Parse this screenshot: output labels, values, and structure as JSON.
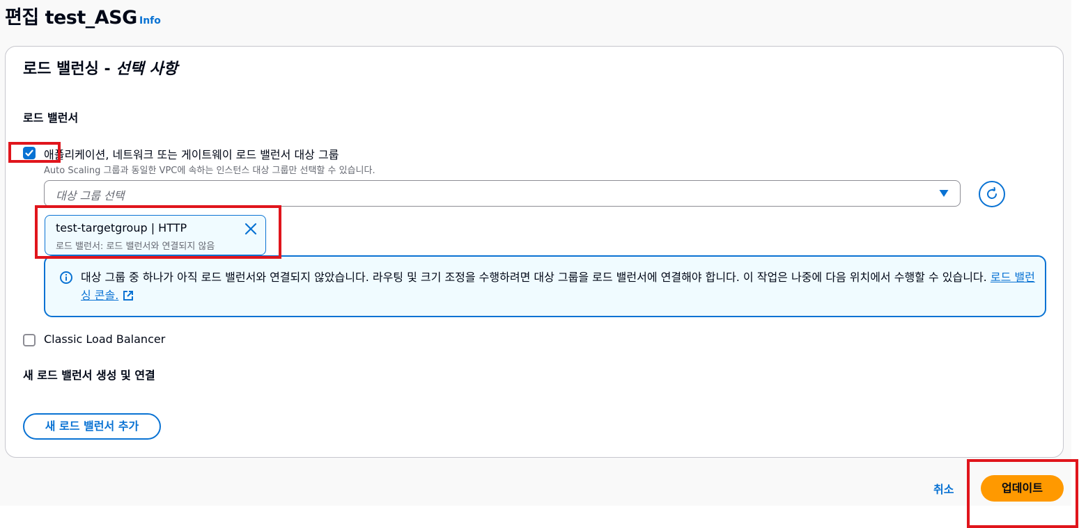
{
  "page": {
    "title": "편집 test_ASG",
    "info_label": "Info"
  },
  "container": {
    "header_main": "로드 밸런싱 - ",
    "header_italic": "선택 사항"
  },
  "load_balancer": {
    "section_label": "로드 밸런서",
    "target_group_option": {
      "label": "애플리케이션, 네트워크 또는 게이트웨이 로드 밸런서 대상 그룹",
      "description": "Auto Scaling 그룹과 동일한 VPC에 속하는 인스턴스 대상 그룹만 선택할 수 있습니다.",
      "checked": true
    },
    "select": {
      "placeholder": "대상 그룹 선택"
    },
    "token": {
      "title": "test-targetgroup | HTTP",
      "description": "로드 밸런서: 로드 밸런서와 연결되지 않음"
    },
    "alert": {
      "text": "대상 그룹 중 하나가 아직 로드 밸런서와 연결되지 않았습니다. 라우팅 및 크기 조정을 수행하려면 대상 그룹을 로드 밸런서에 연결해야 합니다. 이 작업은 나중에 다음 위치에서 수행할 수 있습니다.",
      "link_text": "로드 밸런싱 콘솔."
    },
    "classic_option": {
      "label": "Classic Load Balancer",
      "checked": false
    }
  },
  "new_load_balancer": {
    "section_label": "새 로드 밸런서 생성 및 연결",
    "add_button": "새 로드 밸런서 추가"
  },
  "footer": {
    "cancel": "취소",
    "update": "업데이트"
  },
  "colors": {
    "accent": "#0972d3",
    "primary_button": "#ff9900",
    "highlight": "#e0151c"
  }
}
